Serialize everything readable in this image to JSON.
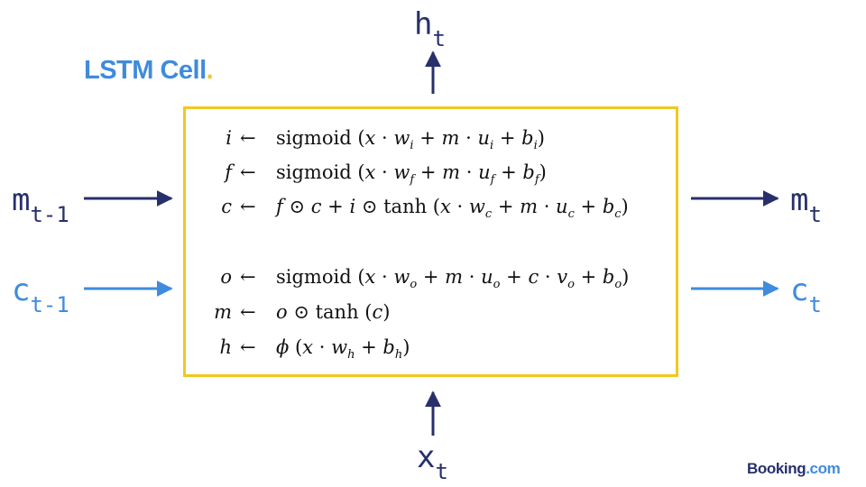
{
  "title": {
    "text": "LSTM Cell",
    "dot": ".",
    "color": "#3f8bdd",
    "dot_color": "#f2c81e"
  },
  "cell": {
    "border_color": "#f2c81e"
  },
  "inputs": {
    "m_prev": {
      "main": "m",
      "sub": "t-1"
    },
    "c_prev": {
      "main": "c",
      "sub": "t-1"
    },
    "x": {
      "main": "x",
      "sub": "t"
    }
  },
  "outputs": {
    "h": {
      "main": "h",
      "sub": "t"
    },
    "m": {
      "main": "m",
      "sub": "t"
    },
    "c": {
      "main": "c",
      "sub": "t"
    }
  },
  "colors": {
    "dark": "#27306b",
    "light": "#3f8bdd"
  },
  "equations": [
    {
      "lhs": "i",
      "arrow": "←"
    },
    {
      "lhs": "f",
      "arrow": "←"
    },
    {
      "lhs": "c",
      "arrow": "←"
    },
    {
      "lhs": "o",
      "arrow": "←"
    },
    {
      "lhs": "m",
      "arrow": "←"
    },
    {
      "lhs": "h",
      "arrow": "←"
    }
  ],
  "brand": {
    "name": "Booking",
    "suffix": ".com",
    "color": "#27306b",
    "suffix_color": "#3f8bdd"
  }
}
